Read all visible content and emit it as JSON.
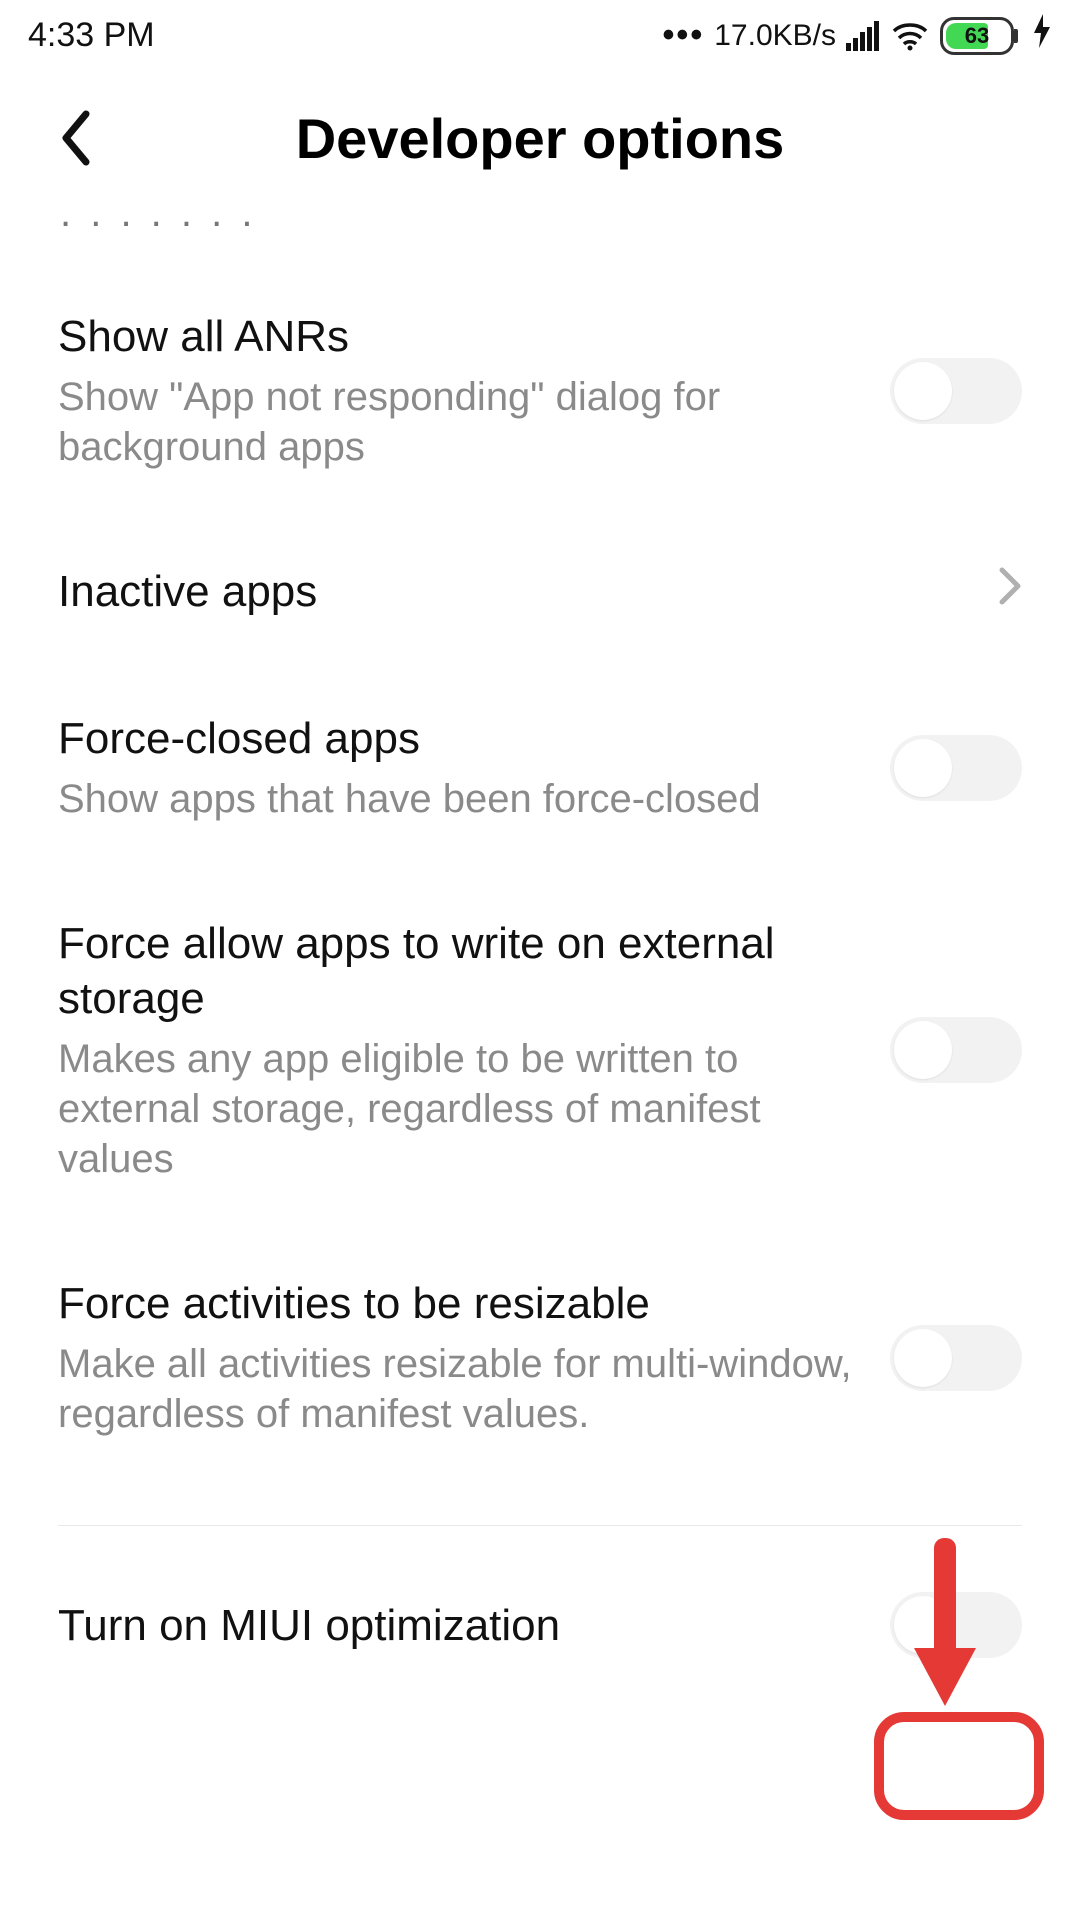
{
  "status_bar": {
    "time": "4:33 PM",
    "dots": "•••",
    "net_speed": "17.0KB/s",
    "battery_pct": "63"
  },
  "header": {
    "title": "Developer options"
  },
  "items": {
    "anrs": {
      "title": "Show all ANRs",
      "sub": "Show \"App not responding\" dialog for background apps"
    },
    "inactive": {
      "title": "Inactive apps"
    },
    "force_closed": {
      "title": "Force-closed apps",
      "sub": "Show apps that have been force-closed"
    },
    "ext_storage": {
      "title": "Force allow apps to write on external storage",
      "sub": "Makes any app eligible to be written to external storage, regardless of manifest values"
    },
    "resizable": {
      "title": "Force activities to be resizable",
      "sub": "Make all activities resizable for multi-window, regardless of manifest values."
    },
    "miui": {
      "title": "Turn on MIUI optimization"
    }
  }
}
